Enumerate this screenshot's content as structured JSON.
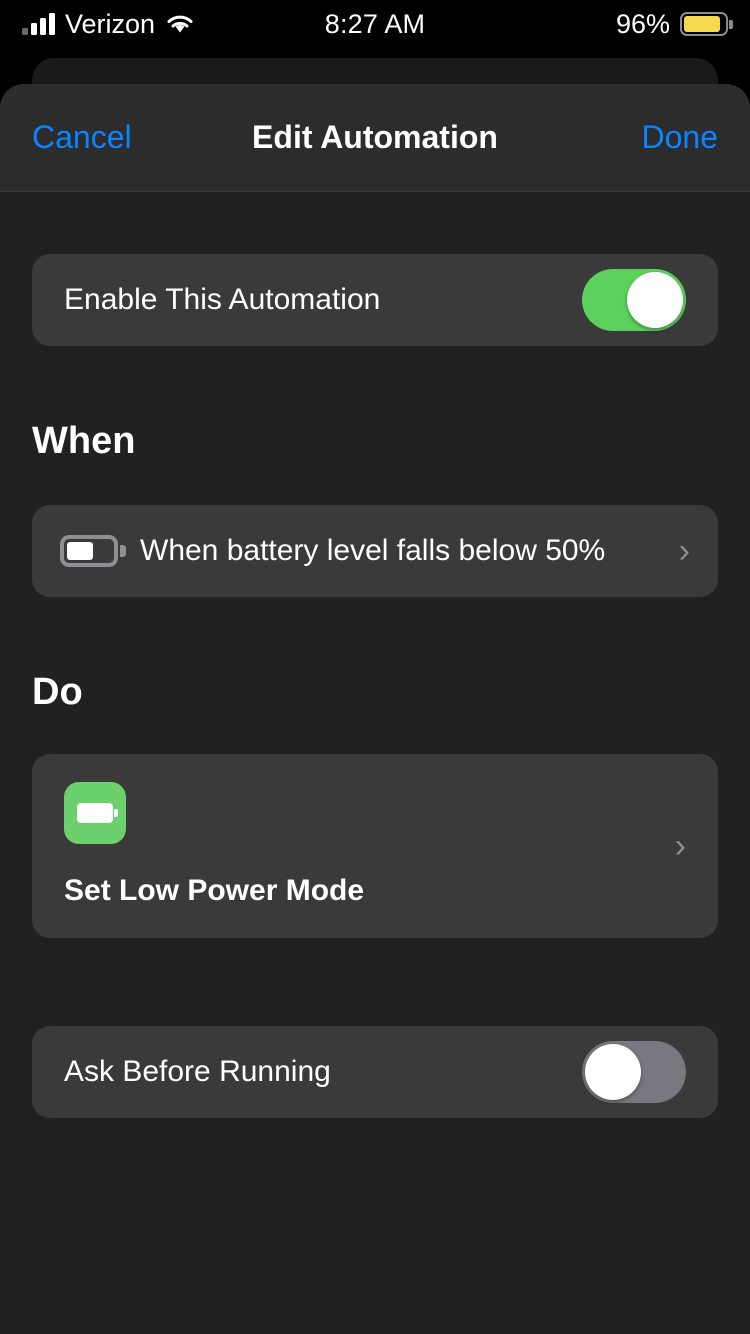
{
  "status_bar": {
    "carrier": "Verizon",
    "signal_icon": "cellular-signal-icon",
    "signal_bars_filled": 3,
    "signal_bars_total": 4,
    "wifi_icon": "wifi-icon",
    "time": "8:27 AM",
    "battery_percent": "96%",
    "battery_icon": "battery-icon",
    "battery_fill_color": "#f5d94f"
  },
  "navbar": {
    "cancel_label": "Cancel",
    "title": "Edit Automation",
    "done_label": "Done",
    "tint_color": "#0a84ff"
  },
  "enable_row": {
    "label": "Enable This Automation",
    "toggle_state": "on",
    "toggle_on_color": "#5cd15c"
  },
  "when_section": {
    "title": "When",
    "trigger": {
      "icon": "battery-outline-icon",
      "label": "When battery level falls below 50%",
      "threshold": "50%",
      "chevron_icon": "chevron-right-icon"
    }
  },
  "do_section": {
    "title": "Do",
    "action": {
      "icon": "low-power-mode-battery-icon",
      "icon_color": "#6cd06c",
      "label": "Set Low Power Mode",
      "chevron_icon": "chevron-right-icon"
    }
  },
  "ask_row": {
    "label": "Ask Before Running",
    "toggle_state": "off",
    "toggle_off_color": "#787880"
  }
}
